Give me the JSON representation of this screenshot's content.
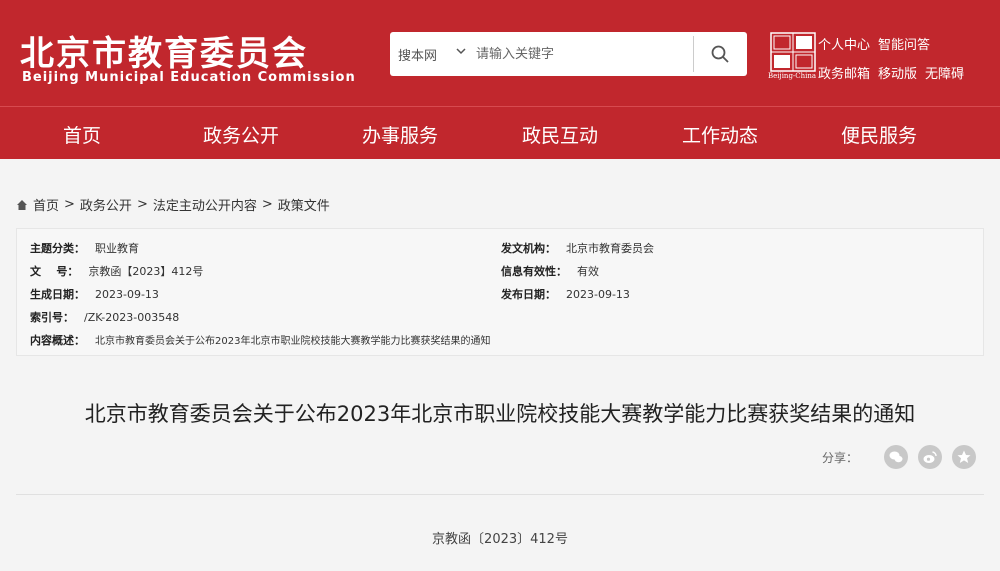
{
  "header": {
    "logo_cn": "北京市教育委员会",
    "logo_en": "Beijing Municipal Education Commission",
    "search": {
      "scope": "搜本网",
      "placeholder": "请输入关键字"
    },
    "seal_caption": "Beijing-China",
    "links_row1": [
      "个人中心",
      "智能问答"
    ],
    "links_row2": [
      "政务邮箱",
      "移动版",
      "无障碍"
    ]
  },
  "nav": [
    "首页",
    "政务公开",
    "办事服务",
    "政民互动",
    "工作动态",
    "便民服务"
  ],
  "breadcrumb": {
    "items": [
      "首页",
      "政务公开",
      "法定主动公开内容",
      "政策文件"
    ],
    "separator": ">"
  },
  "meta": {
    "topic": {
      "label": "主题分类：",
      "value": "职业教育"
    },
    "issuer": {
      "label": "发文机构：",
      "value": "北京市教育委员会"
    },
    "doc_no": {
      "label": "文    号：",
      "value": "京教函【2023】412号"
    },
    "validity": {
      "label": "信息有效性：",
      "value": "有效"
    },
    "created": {
      "label": "生成日期：",
      "value": "2023-09-13"
    },
    "published": {
      "label": "发布日期：",
      "value": "2023-09-13"
    },
    "index_no": {
      "label": "索引号：",
      "value": "/ZK-2023-003548"
    },
    "summary": {
      "label": "内容概述：",
      "value": "北京市教育委员会关于公布2023年北京市职业院校技能大赛教学能力比赛获奖结果的通知"
    }
  },
  "article": {
    "title": "北京市教育委员会关于公布2023年北京市职业院校技能大赛教学能力比赛获奖结果的通知",
    "share_label": "分享：",
    "doc_number": "京教函〔2023〕412号"
  },
  "colors": {
    "brand": "#c1272d"
  }
}
